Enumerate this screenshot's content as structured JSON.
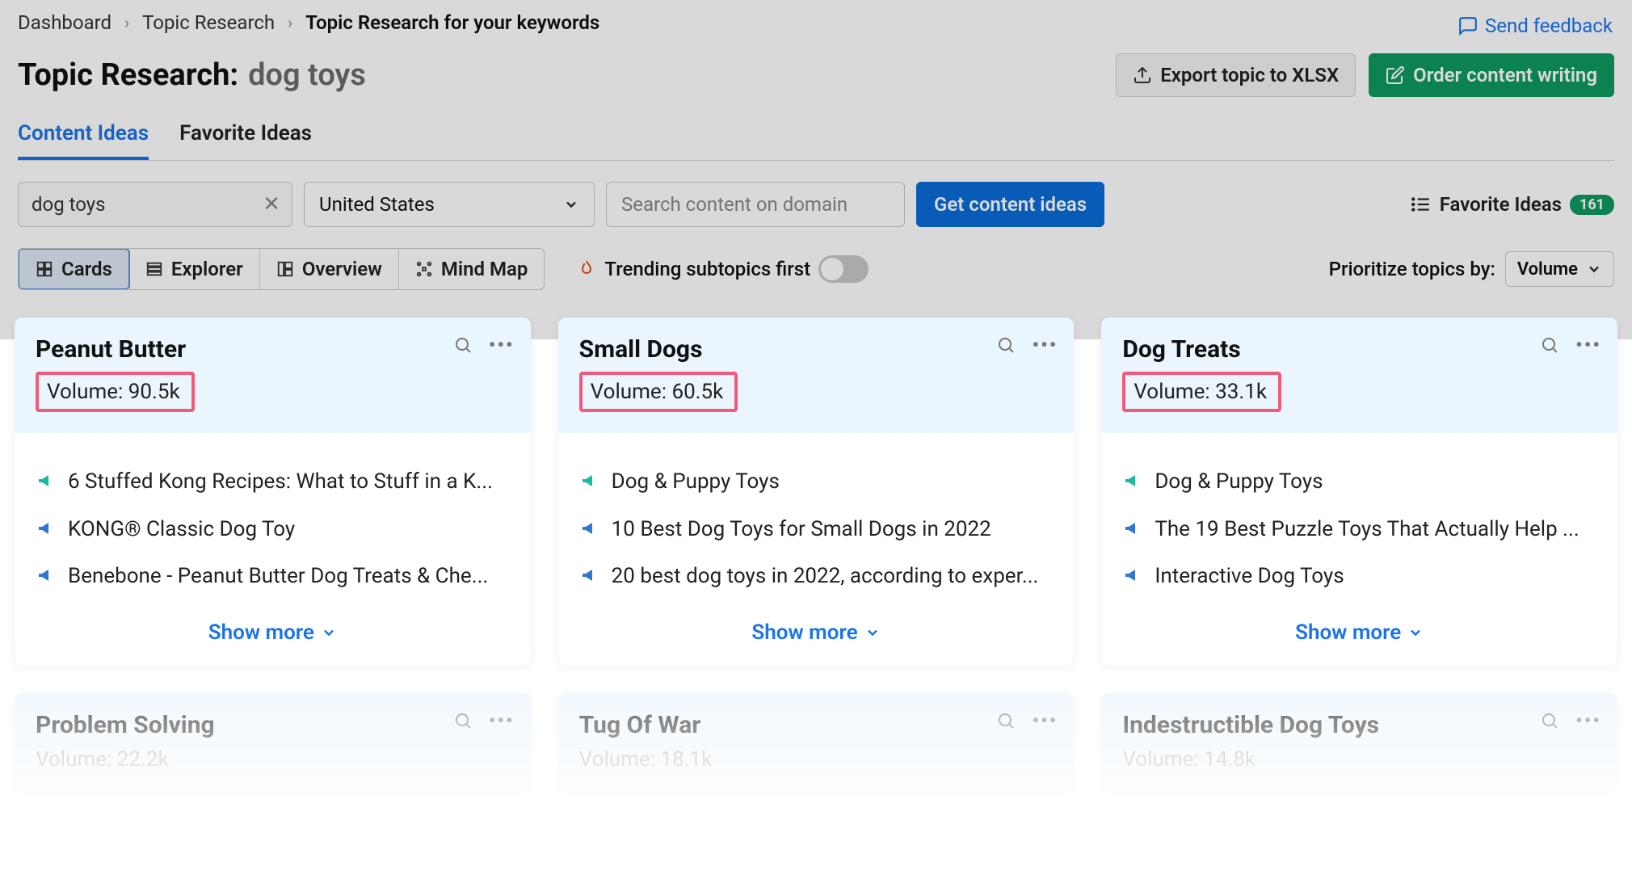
{
  "breadcrumb": {
    "items": [
      "Dashboard",
      "Topic Research",
      "Topic Research for your keywords"
    ]
  },
  "feedback": {
    "label": "Send feedback"
  },
  "page_title": {
    "prefix": "Topic Research:",
    "keyword": "dog toys"
  },
  "buttons": {
    "export": "Export topic to XLSX",
    "order": "Order content writing",
    "get_ideas": "Get content ideas"
  },
  "tabs": {
    "items": [
      "Content Ideas",
      "Favorite Ideas"
    ],
    "active_index": 0
  },
  "search": {
    "keyword_value": "dog toys",
    "country_value": "United States",
    "domain_placeholder": "Search content on domain"
  },
  "favorite_ideas": {
    "label": "Favorite Ideas",
    "count": "161"
  },
  "views": {
    "items": [
      "Cards",
      "Explorer",
      "Overview",
      "Mind Map"
    ],
    "active_index": 0
  },
  "trending": {
    "label": "Trending subtopics first",
    "enabled": false
  },
  "prioritize": {
    "label": "Prioritize topics by:",
    "value": "Volume"
  },
  "cards_row1": [
    {
      "title": "Peanut Butter",
      "volume_label": "Volume:",
      "volume_value": "90.5k",
      "ideas": [
        {
          "color": "green",
          "text": "6 Stuffed Kong Recipes: What to Stuff in a K..."
        },
        {
          "color": "blue",
          "text": "KONG® Classic Dog Toy"
        },
        {
          "color": "blue",
          "text": "Benebone - Peanut Butter Dog Treats & Che..."
        }
      ],
      "show_more": "Show more"
    },
    {
      "title": "Small Dogs",
      "volume_label": "Volume:",
      "volume_value": "60.5k",
      "ideas": [
        {
          "color": "green",
          "text": "Dog & Puppy Toys"
        },
        {
          "color": "blue",
          "text": "10 Best Dog Toys for Small Dogs in 2022"
        },
        {
          "color": "blue",
          "text": "20 best dog toys in 2022, according to exper..."
        }
      ],
      "show_more": "Show more"
    },
    {
      "title": "Dog Treats",
      "volume_label": "Volume:",
      "volume_value": "33.1k",
      "ideas": [
        {
          "color": "green",
          "text": "Dog & Puppy Toys"
        },
        {
          "color": "blue",
          "text": "The 19 Best Puzzle Toys That Actually Help ..."
        },
        {
          "color": "blue",
          "text": "Interactive Dog Toys"
        }
      ],
      "show_more": "Show more"
    }
  ],
  "cards_row2": [
    {
      "title": "Problem Solving",
      "volume_label": "Volume:",
      "volume_value": "22.2k"
    },
    {
      "title": "Tug Of War",
      "volume_label": "Volume:",
      "volume_value": "18.1k"
    },
    {
      "title": "Indestructible Dog Toys",
      "volume_label": "Volume:",
      "volume_value": "14.8k"
    }
  ]
}
